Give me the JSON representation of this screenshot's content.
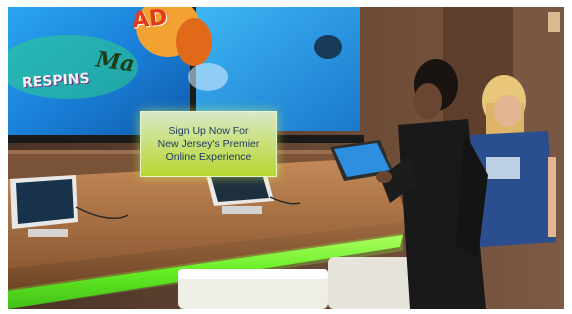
{
  "sign": {
    "line1": "Sign Up Now For",
    "line2": "New Jersey's Premier",
    "line3": "Online Experience"
  },
  "screen_left": {
    "logo_text_1": "Ma",
    "logo_text_2": "RESPINS",
    "ad_text": "AD"
  },
  "colors": {
    "led_strip": "#58e81a",
    "screen_glow": "#1a8fe0",
    "wall": "#6b4a35",
    "counter": "#a86a3c"
  }
}
